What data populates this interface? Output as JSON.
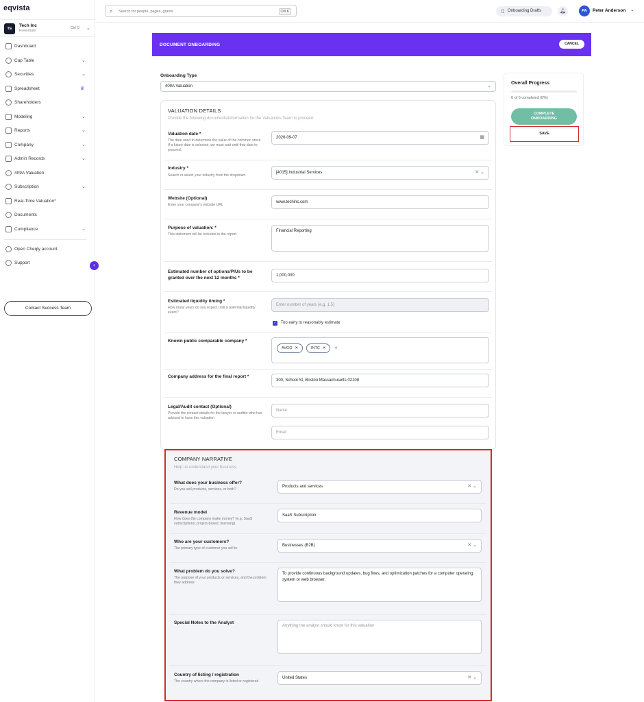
{
  "app": {
    "logo": "eqvista"
  },
  "company": {
    "initials": "TE",
    "name": "Tech Inc",
    "plan": "Freemium",
    "shortcut": "Ctrl O"
  },
  "sidebar": {
    "items": [
      {
        "label": "Dashboard",
        "icon": "grid-icon"
      },
      {
        "label": "Cap Table",
        "icon": "pie-icon"
      },
      {
        "label": "Securities",
        "icon": "securities-icon"
      },
      {
        "label": "Spreadsheet",
        "icon": "table-icon"
      },
      {
        "label": "Shareholders",
        "icon": "users-icon"
      },
      {
        "label": "Modeling",
        "icon": "modeling-icon"
      },
      {
        "label": "Reports",
        "icon": "chart-icon"
      },
      {
        "label": "Company",
        "icon": "company-icon"
      },
      {
        "label": "Admin Records",
        "icon": "records-icon"
      },
      {
        "label": "409A Valuation",
        "icon": "shield-icon"
      },
      {
        "label": "Subscription",
        "icon": "subscription-icon"
      },
      {
        "label": "Real-Time Valuation*",
        "icon": "trend-icon"
      },
      {
        "label": "Documents",
        "icon": "document-icon"
      },
      {
        "label": "Compliance",
        "icon": "compliance-icon"
      },
      {
        "label": "Open Cheqly account",
        "icon": "cheqly-icon"
      },
      {
        "label": "Support",
        "icon": "help-icon"
      }
    ],
    "contact_button": "Contact Success Team"
  },
  "topbar": {
    "search_placeholder": "Search for people, pages, grants",
    "search_shortcut": "Ctrl K",
    "drafts_label": "Onboarding Drafts",
    "user_initials": "PA",
    "user_name": "Peter Anderson"
  },
  "banner": {
    "title": "DOCUMENT ONBOARDING",
    "cancel_label": "CANCEL"
  },
  "onboarding_type": {
    "label": "Onboarding Type",
    "value": "409A Valuation"
  },
  "valuation": {
    "title": "VALUATION DETAILS",
    "subtitle": "Provide the following documents/information for the Valuations Team to proceed.",
    "date": {
      "label": "Valuation date *",
      "hint": "The date used to determine the value of the common stock. If a future date is selected, we must wait until that date to proceed.",
      "value": "2026-09-07"
    },
    "industry": {
      "label": "Industry *",
      "hint": "Search or select your industry from the dropdown",
      "value": "[4015] Industrial Services"
    },
    "website": {
      "label": "Website (Optional)",
      "hint": "Enter your company's website URL",
      "value": "www.techinc.com"
    },
    "purpose": {
      "label": "Purpose of valuation: *",
      "hint": "This statement will be included in the report.",
      "value": "Financial Reporting"
    },
    "options": {
      "label_line1": "Estimated number of options/PIUs to be",
      "label_line2": "granted over the next 12 months *",
      "value": "1,000,000"
    },
    "liquidity": {
      "label": "Estimated liquidity timing *",
      "hint": "How many years do you expect until a potential liquidity event?",
      "placeholder": "Enter number of years (e.g. 1.5)",
      "checkbox_label": "Too early to reasonably estimate"
    },
    "comparable": {
      "label": "Known public comparable company *",
      "chips": [
        "AVGO",
        "INTC"
      ]
    },
    "address": {
      "label": "Company address for the final report *",
      "value": "300, School St, Boston Massachusetts 02108"
    },
    "legal": {
      "label": "Legal/Audit contact (Optional)",
      "hint": "Provide the contact details for the lawyer or auditor who has advised to have this valuation",
      "name_placeholder": "Name",
      "email_placeholder": "Email"
    }
  },
  "narrative": {
    "title": "COMPANY NARRATIVE",
    "subtitle": "Help us understand your business.",
    "offer": {
      "label": "What does your business offer?",
      "hint": "Do you sell products, services, or both?",
      "value": "Products and services"
    },
    "revenue": {
      "label": "Revenue model",
      "hint": "How does the company make money? (e.g. SaaS subscriptions, project-based, licensing)",
      "value": "SaaS Subscription"
    },
    "customers": {
      "label": "Who are your customers?",
      "hint": "The primary type of customer you sell to",
      "value": "Businesses (B2B)"
    },
    "problem": {
      "label": "What problem do you solve?",
      "hint": "The purpose of your products or services, and the problem they address",
      "value": "To provide continuous background updates, bug fixes, and optimization patches for a computer operating system or web browser."
    },
    "notes": {
      "label": "Special Notes to the Analyst",
      "placeholder": "Anything the analyst should know for this valuation"
    },
    "country": {
      "label": "Country of listing / registration",
      "hint": "The country where the company is listed or registered",
      "value": "United States"
    }
  },
  "progress": {
    "title": "Overall Progress",
    "percent": 0,
    "text": "0 of 6 completed (0%)",
    "complete_line1": "COMPLETE",
    "complete_line2": "ONBOARDING",
    "save_label": "SAVE"
  },
  "colors": {
    "brand": "#6b31f1",
    "complete": "#72bda5",
    "highlight": "#d42b2b"
  }
}
